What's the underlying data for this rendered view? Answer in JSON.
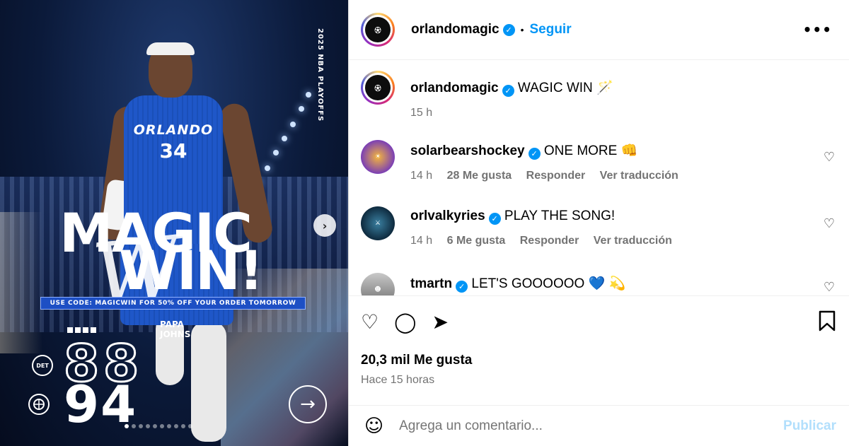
{
  "media": {
    "playoffs_label": "2025 NBA PLAYOFFS",
    "jersey_name": "ORLANDO",
    "jersey_number": "34",
    "headline_top": "MAGIC",
    "headline_bottom": "WIN!",
    "headline_script": "W",
    "promo": "USE CODE: MAGICWIN FOR 50% OFF YOUR ORDER TOMORROW",
    "sponsor_line1": "PAPA",
    "sponsor_line2": "JOHNS",
    "away_team": "DET",
    "away_score": "88",
    "home_score": "94",
    "next_arrow": "→",
    "carousel_next": "›",
    "carousel_total": 10,
    "carousel_active": 0
  },
  "header": {
    "username": "orlandomagic",
    "verified_glyph": "✓",
    "separator": "•",
    "follow_label": "Seguir",
    "more_label": "•••"
  },
  "caption": {
    "username": "orlandomagic",
    "text": "WAGIC WIN 🪄",
    "time": "15 h"
  },
  "comments": [
    {
      "username": "solarbearshockey",
      "text": "ONE MORE 👊",
      "time": "14 h",
      "likes": "28 Me gusta",
      "reply": "Responder",
      "translate": "Ver traducción"
    },
    {
      "username": "orlvalkyries",
      "text": "PLAY THE SONG!",
      "time": "14 h",
      "likes": "6 Me gusta",
      "reply": "Responder",
      "translate": "Ver traducción"
    },
    {
      "username": "tmartn",
      "text": "LET'S GOOOOOO 💙 💫"
    }
  ],
  "actions": {
    "like_icon": "♡",
    "comment_icon": "◯",
    "share_icon": "➤",
    "save_icon": "🔖",
    "likes": "20,3 mil Me gusta",
    "posted": "Hace 15 horas"
  },
  "composer": {
    "emoji_icon": "☺",
    "placeholder": "Agrega un comentario...",
    "publish_label": "Publicar"
  },
  "colors": {
    "accent": "#0095f6",
    "muted": "#737373",
    "publish_disabled": "#b2dffc"
  }
}
